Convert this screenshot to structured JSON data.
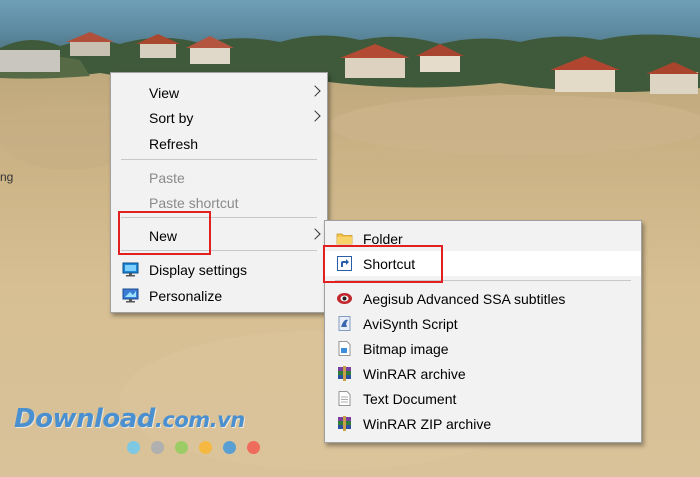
{
  "desktop": {
    "edge_label": "ng"
  },
  "context_menu": {
    "items": [
      {
        "label": "View",
        "has_submenu": true,
        "enabled": true
      },
      {
        "label": "Sort by",
        "has_submenu": true,
        "enabled": true
      },
      {
        "label": "Refresh",
        "has_submenu": false,
        "enabled": true
      },
      {
        "label": "Paste",
        "has_submenu": false,
        "enabled": false
      },
      {
        "label": "Paste shortcut",
        "has_submenu": false,
        "enabled": false
      },
      {
        "label": "New",
        "has_submenu": true,
        "enabled": true
      },
      {
        "label": "Display settings",
        "has_submenu": false,
        "enabled": true,
        "icon": "display-settings-icon"
      },
      {
        "label": "Personalize",
        "has_submenu": false,
        "enabled": true,
        "icon": "personalize-icon"
      }
    ]
  },
  "new_submenu": {
    "items": [
      {
        "label": "Folder",
        "icon": "folder-icon"
      },
      {
        "label": "Shortcut",
        "icon": "shortcut-icon",
        "highlighted": true
      },
      {
        "label": "Aegisub Advanced SSA subtitles",
        "icon": "aegisub-icon"
      },
      {
        "label": "AviSynth Script",
        "icon": "avisynth-icon"
      },
      {
        "label": "Bitmap image",
        "icon": "bitmap-icon"
      },
      {
        "label": "WinRAR archive",
        "icon": "winrar-icon"
      },
      {
        "label": "Text Document",
        "icon": "text-document-icon"
      },
      {
        "label": "WinRAR ZIP archive",
        "icon": "winrar-zip-icon"
      }
    ]
  },
  "watermark": {
    "brand": "Download",
    "domain": ".com.vn",
    "dot_colors": [
      "#7ec8e3",
      "#b0b0b0",
      "#9ccc65",
      "#f5b942",
      "#5a9fd4",
      "#ef6b5b"
    ]
  },
  "colors": {
    "menu_bg": "#f2f2f2",
    "highlight_box": "#e0211f",
    "disabled_text": "#8a8a8a"
  }
}
